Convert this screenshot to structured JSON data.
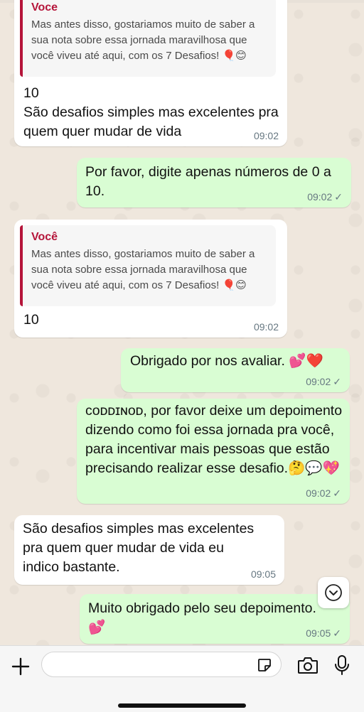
{
  "colors": {
    "incoming_bubble": "#ffffff",
    "outgoing_bubble": "#d9fdd3",
    "quote_accent": "#b5153a",
    "chat_background": "#efe7dd"
  },
  "messages": {
    "m1": {
      "direction": "incoming",
      "quote_author": "Voce",
      "quote_text": "Mas antes disso, gostariamos muito de saber a sua nota sobre essa jornada maravilhosa que você viveu até aqui, com os 7 Desafios! 🎈😊",
      "text": "10\nSão desafios simples mas excelentes pra quem quer mudar de vida",
      "time": "09:02"
    },
    "m2": {
      "direction": "outgoing",
      "text": "Por favor, digite apenas números de 0 a 10.",
      "time": "09:02",
      "status": "✓"
    },
    "m3": {
      "direction": "incoming",
      "quote_author": "Você",
      "quote_text": "Mas antes disso, gostariamos muito de saber a sua nota sobre essa jornada maravilhosa que você viveu até aqui, com os 7 Desafios! 🎈😊",
      "text": "10",
      "time": "09:02"
    },
    "m4": {
      "direction": "outgoing",
      "text": "Obrigado por nos avaliar. 💕❤️",
      "time": "09:02",
      "status": "✓"
    },
    "m5": {
      "direction": "outgoing",
      "text": "ᴄᴏᴅᴅɪɴᴏᴅ, por favor deixe um depoimento dizendo como foi essa jornada pra você, para incentivar mais pessoas que estão precisando realizar esse desafio.🤔💬💖",
      "time": "09:02",
      "status": "✓"
    },
    "m6": {
      "direction": "incoming",
      "text": "São desafios simples mas excelentes pra quem quer mudar de vida eu indico bastante.",
      "time": "09:05"
    },
    "m7": {
      "direction": "outgoing",
      "text": "Muito obrigado pelo seu depoimento.\n💕",
      "time": "09:05",
      "status": "✓"
    }
  },
  "icons": {
    "scroll_down": "chevron-down-icon",
    "attach": "plus-icon",
    "sticker": "sticker-icon",
    "camera": "camera-icon",
    "mic": "microphone-icon"
  }
}
